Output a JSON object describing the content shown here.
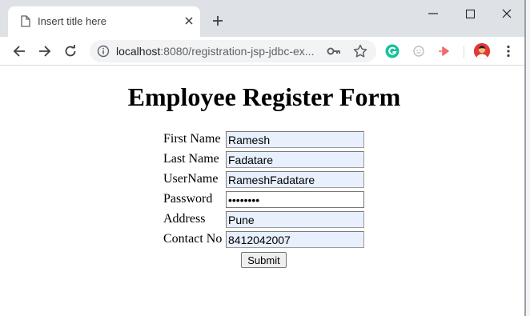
{
  "browser": {
    "tab_title": "Insert title here",
    "url_host": "localhost",
    "url_rest": ":8080/registration-jsp-jdbc-ex...",
    "extensions": [
      "grammarly-icon",
      "extension-face-icon",
      "extension-arrow-icon"
    ],
    "accent_color": "#1a73e8"
  },
  "page": {
    "title": "Employee Register Form",
    "fields": [
      {
        "label": "First Name",
        "value": "Ramesh",
        "type": "text"
      },
      {
        "label": "Last Name",
        "value": "Fadatare",
        "type": "text"
      },
      {
        "label": "UserName",
        "value": "RameshFadatare",
        "type": "text"
      },
      {
        "label": "Password",
        "value": "********",
        "type": "password"
      },
      {
        "label": "Address",
        "value": "Pune",
        "type": "text"
      },
      {
        "label": "Contact No",
        "value": "8412042007",
        "type": "text"
      }
    ],
    "submit_label": "Submit",
    "autofill_color": "#e8f0fe"
  }
}
